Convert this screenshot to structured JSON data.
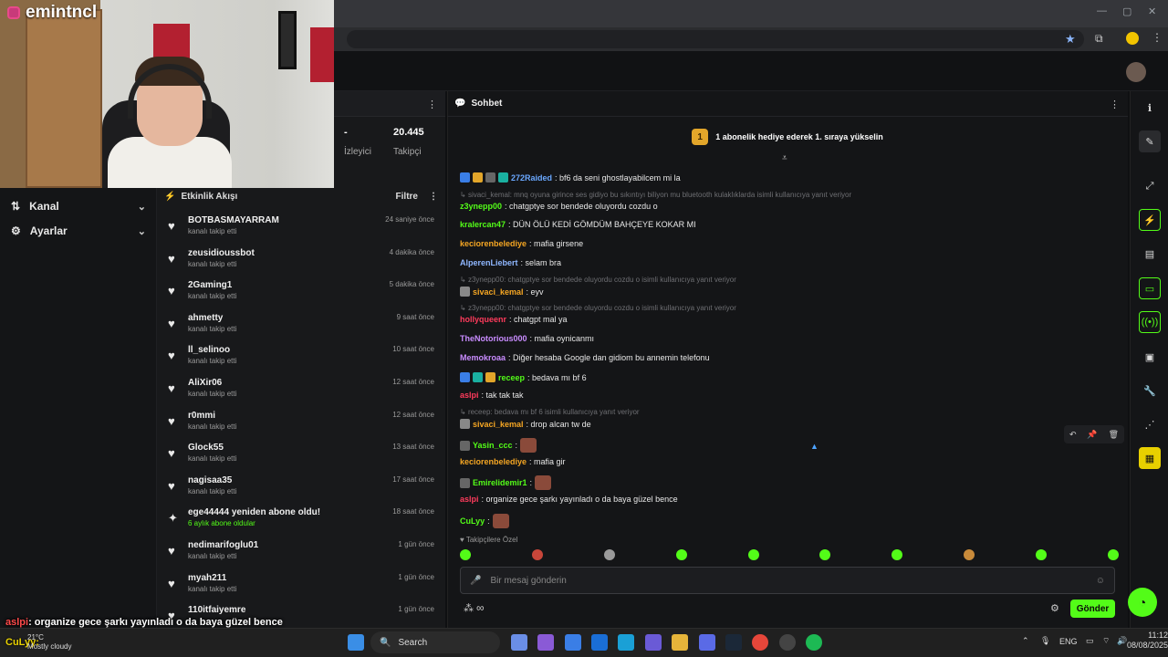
{
  "stream": {
    "name": "emintncl"
  },
  "sidebar": {
    "items": [
      {
        "label": "Kanal",
        "icon": "channel-icon"
      },
      {
        "label": "Ayarlar",
        "icon": "gear-icon"
      }
    ]
  },
  "stats": {
    "viewers_value": "-",
    "viewers_label": "İzleyici",
    "followers_value": "20.445",
    "followers_label": "Takipçi"
  },
  "feed": {
    "title": "Etkinlik Akışı",
    "filter": "Filtre",
    "items": [
      {
        "name": "BOTBASMAYARRAM",
        "sub": "kanalı takip etti",
        "time": "24 saniye önce"
      },
      {
        "name": "zeusidioussbot",
        "sub": "kanalı takip etti",
        "time": "4 dakika önce"
      },
      {
        "name": "2Gaming1",
        "sub": "kanalı takip etti",
        "time": "5 dakika önce"
      },
      {
        "name": "ahmetty",
        "sub": "kanalı takip etti",
        "time": "9 saat önce"
      },
      {
        "name": "ll_selinoo",
        "sub": "kanalı takip etti",
        "time": "10 saat önce"
      },
      {
        "name": "AliXir06",
        "sub": "kanalı takip etti",
        "time": "12 saat önce"
      },
      {
        "name": "r0mmi",
        "sub": "kanalı takip etti",
        "time": "12 saat önce"
      },
      {
        "name": "Glock55",
        "sub": "kanalı takip etti",
        "time": "13 saat önce"
      },
      {
        "name": "nagisaa35",
        "sub": "kanalı takip etti",
        "time": "17 saat önce"
      },
      {
        "name": "ege44444 yeniden abone oldu!",
        "sub": "6 aylık abone oldular",
        "time": "18 saat önce"
      },
      {
        "name": "nedimarifoglu01",
        "sub": "kanalı takip etti",
        "time": "1 gün önce"
      },
      {
        "name": "myah211",
        "sub": "kanalı takip etti",
        "time": "1 gün önce"
      },
      {
        "name": "110itfaiyemre",
        "sub": "",
        "time": "1 gün önce"
      }
    ]
  },
  "chat": {
    "title": "Sohbet",
    "pinned_badge": "1",
    "pinned": "1 abonelik hediye ederek 1. sıraya yükselin",
    "messages": [
      {
        "user": "272Raided",
        "color": "#6aa8ff",
        "text": ": bf6 da seni ghostlayabilcem mi la"
      },
      {
        "reply": "sivaci_kemal: mnq oyuna girince ses gidiyo bu sıkıntıyı biliyon mu bluetooth kulaklıklarda isimli kullanıcıya yanıt veriyor"
      },
      {
        "user": "z3ynepp00",
        "color": "#53fc18",
        "text": ": chatgptye sor bendede oluyordu cozdu o"
      },
      {
        "user": "kralercan47",
        "color": "#53fc18",
        "text": ": DÜN ÖLÜ KEDİ GÖMDÜM BAHÇEYE KOKAR MI"
      },
      {
        "user": "keciorenbelediye",
        "color": "#f5a623",
        "text": ": mafia girsene"
      },
      {
        "user": "AlperenLiebert",
        "color": "#8fb7ff",
        "text": ": selam bra"
      },
      {
        "reply": "z3ynepp00: chatgptye sor bendede oluyordu cozdu o isimli kullanıcıya yanıt veriyor"
      },
      {
        "user": "sivaci_kemal",
        "color": "#f5a623",
        "text": ": eyv"
      },
      {
        "reply": "z3ynepp00: chatgptye sor bendede oluyordu cozdu o isimli kullanıcıya yanıt veriyor"
      },
      {
        "user": "hollyqueenr",
        "color": "#ff3b5c",
        "text": ": chatgpt mal ya"
      },
      {
        "user": "TheNotorious000",
        "color": "#c98cff",
        "text": ": mafia oynicanmı"
      },
      {
        "user": "Memokroaa",
        "color": "#c98cff",
        "text": ": Diğer hesaba Google dan gidiom bu annemin telefonu"
      },
      {
        "user": "receep",
        "color": "#53fc18",
        "text": ": bedava mı bf 6"
      },
      {
        "user": "aslpi",
        "color": "#ff3b5c",
        "text": ": tak tak tak"
      },
      {
        "reply": "receep: bedava mı bf 6 isimli kullanıcıya yanıt veriyor"
      },
      {
        "user": "sivaci_kemal",
        "color": "#f5a623",
        "text": ": drop alcan tw de"
      },
      {
        "user": "Yasin_ccc",
        "color": "#53fc18",
        "text": ":"
      },
      {
        "user": "keciorenbelediye",
        "color": "#f5a623",
        "text": ": mafia gir"
      },
      {
        "user": "Emirelidemir1",
        "color": "#53fc18",
        "text": ":"
      },
      {
        "user": "aslpi",
        "color": "#ff3b5c",
        "text": ": organize gece şarkı yayınladı o da baya güzel bence"
      },
      {
        "user": "CuLyy",
        "color": "#53fc18",
        "text": ":"
      }
    ],
    "emote_label": "Takipçilere Özel",
    "input_placeholder": "Bir mesaj gönderin",
    "send": "Gönder"
  },
  "overlay": {
    "user": "aslpi",
    "text": ": organize gece şarkı yayınladı o da baya güzel bence"
  },
  "taskbar": {
    "search": "Search",
    "weather_temp": "21°C",
    "weather_desc": "Mostly cloudy",
    "lang": "ENG",
    "time": "11:12",
    "date": "08/08/2025"
  },
  "overlay_tag": "CuLyy:"
}
